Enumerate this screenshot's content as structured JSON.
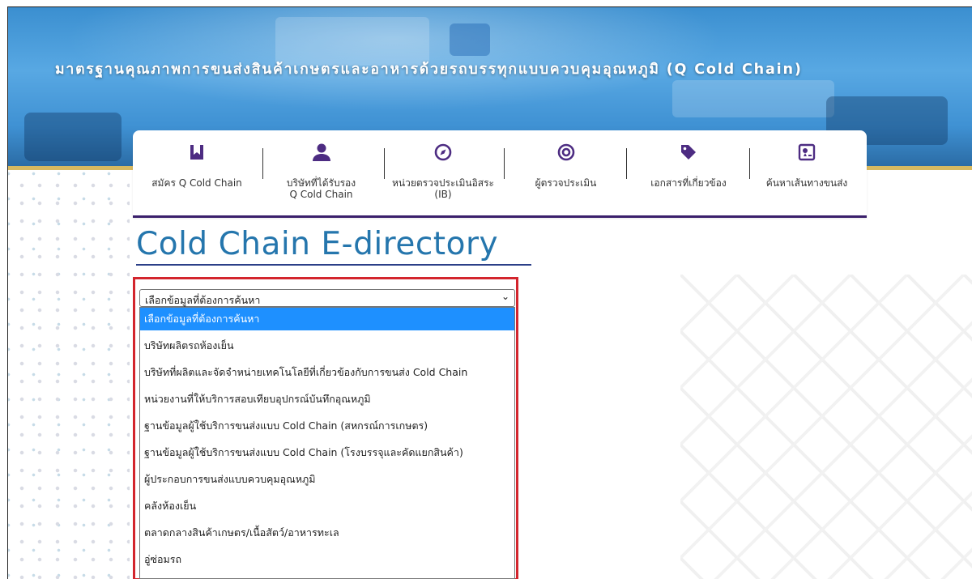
{
  "header": {
    "title": "มาตรฐานคุณภาพการขนส่งสินค้าเกษตรและอาหารด้วยรถบรรทุกแบบควบคุมอุณหภูมิ (Q Cold Chain)"
  },
  "nav": {
    "items": [
      {
        "icon": "book-icon",
        "line1": "สมัคร Q Cold Chain",
        "line2": ""
      },
      {
        "icon": "user-icon",
        "line1": "บริษัทที่ได้รับรอง",
        "line2": "Q Cold Chain"
      },
      {
        "icon": "compass-icon",
        "line1": "หน่วยตรวจประเมินอิสระ",
        "line2": "(IB)"
      },
      {
        "icon": "target-icon",
        "line1": "ผู้ตรวจประเมิน",
        "line2": ""
      },
      {
        "icon": "tag-icon",
        "line1": "เอกสารที่เกี่ยวข้อง",
        "line2": ""
      },
      {
        "icon": "map-location-icon",
        "line1": "ค้นหาเส้นทางขนส่ง",
        "line2": ""
      }
    ]
  },
  "main": {
    "title": "Cold Chain E-directory"
  },
  "search": {
    "selected": "เลือกข้อมูลที่ต้องการค้นหา",
    "options": [
      "เลือกข้อมูลที่ต้องการค้นหา",
      "บริษัทผลิตรถห้องเย็น",
      "บริษัทที่ผลิตและจัดจำหน่ายเทคโนโลยีที่เกี่ยวข้องกับการขนส่ง Cold Chain",
      "หน่วยงานที่ให้บริการสอบเทียบอุปกรณ์บันทึกอุณหภูมิ",
      "ฐานข้อมูลผู้ใช้บริการขนส่งแบบ Cold Chain (สหกรณ์การเกษตร)",
      "ฐานข้อมูลผู้ใช้บริการขนส่งแบบ Cold Chain (โรงบรรจุและคัดแยกสินค้า)",
      "ผู้ประกอบการขนส่งแบบควบคุมอุณหภูมิ",
      "คลังห้องเย็น",
      "ตลาดกลางสินค้าเกษตร/เนื้อสัตว์/อาหารทะเล",
      "อู่ซ่อมรถ"
    ]
  },
  "colors": {
    "accent_purple": "#4d2c82",
    "title_blue": "#2576ad",
    "highlight_red": "#d3252d",
    "selected_blue": "#1e90ff",
    "gold": "#d7b960"
  }
}
